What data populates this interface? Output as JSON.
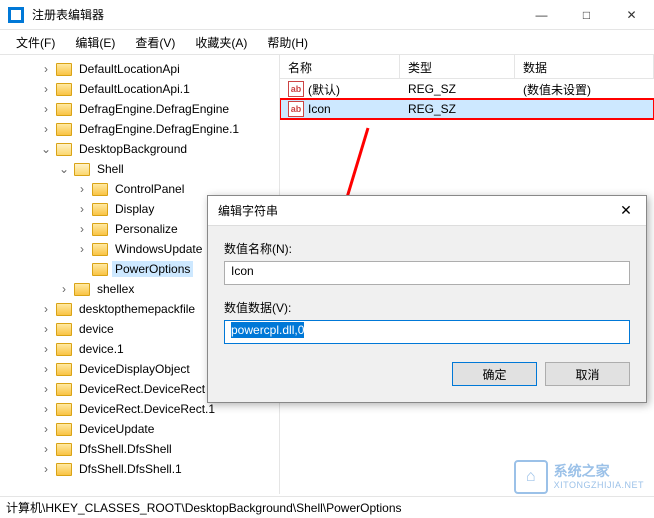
{
  "window": {
    "title": "注册表编辑器"
  },
  "menu": {
    "file": "文件(F)",
    "edit": "编辑(E)",
    "view": "查看(V)",
    "favorites": "收藏夹(A)",
    "help": "帮助(H)"
  },
  "tree": {
    "items": [
      {
        "indent": 40,
        "exp": ">",
        "label": "DefaultLocationApi"
      },
      {
        "indent": 40,
        "exp": ">",
        "label": "DefaultLocationApi.1"
      },
      {
        "indent": 40,
        "exp": ">",
        "label": "DefragEngine.DefragEngine"
      },
      {
        "indent": 40,
        "exp": ">",
        "label": "DefragEngine.DefragEngine.1"
      },
      {
        "indent": 40,
        "exp": "v",
        "label": "DesktopBackground",
        "open": true
      },
      {
        "indent": 58,
        "exp": "v",
        "label": "Shell",
        "open": true
      },
      {
        "indent": 76,
        "exp": ">",
        "label": "ControlPanel"
      },
      {
        "indent": 76,
        "exp": ">",
        "label": "Display"
      },
      {
        "indent": 76,
        "exp": ">",
        "label": "Personalize"
      },
      {
        "indent": 76,
        "exp": ">",
        "label": "WindowsUpdate"
      },
      {
        "indent": 76,
        "exp": "",
        "label": "PowerOptions",
        "selected": true
      },
      {
        "indent": 58,
        "exp": ">",
        "label": "shellex"
      },
      {
        "indent": 40,
        "exp": ">",
        "label": "desktopthemepackfile"
      },
      {
        "indent": 40,
        "exp": ">",
        "label": "device"
      },
      {
        "indent": 40,
        "exp": ">",
        "label": "device.1"
      },
      {
        "indent": 40,
        "exp": ">",
        "label": "DeviceDisplayObject"
      },
      {
        "indent": 40,
        "exp": ">",
        "label": "DeviceRect.DeviceRect"
      },
      {
        "indent": 40,
        "exp": ">",
        "label": "DeviceRect.DeviceRect.1"
      },
      {
        "indent": 40,
        "exp": ">",
        "label": "DeviceUpdate"
      },
      {
        "indent": 40,
        "exp": ">",
        "label": "DfsShell.DfsShell"
      },
      {
        "indent": 40,
        "exp": ">",
        "label": "DfsShell.DfsShell.1"
      }
    ]
  },
  "list": {
    "headers": {
      "name": "名称",
      "type": "类型",
      "data": "数据"
    },
    "rows": [
      {
        "name": "(默认)",
        "type": "REG_SZ",
        "data": "(数值未设置)",
        "boxed": false,
        "highlighted": false
      },
      {
        "name": "Icon",
        "type": "REG_SZ",
        "data": "",
        "boxed": true,
        "highlighted": true
      }
    ]
  },
  "dialog": {
    "title": "编辑字符串",
    "name_label": "数值名称(N):",
    "name_value": "Icon",
    "data_label": "数值数据(V):",
    "data_value": "powercpl.dll,0",
    "ok": "确定",
    "cancel": "取消"
  },
  "pathbar": "计算机\\HKEY_CLASSES_ROOT\\DesktopBackground\\Shell\\PowerOptions",
  "watermark": {
    "cn": "系统之家",
    "en": "XITONGZHIJIA.NET"
  }
}
